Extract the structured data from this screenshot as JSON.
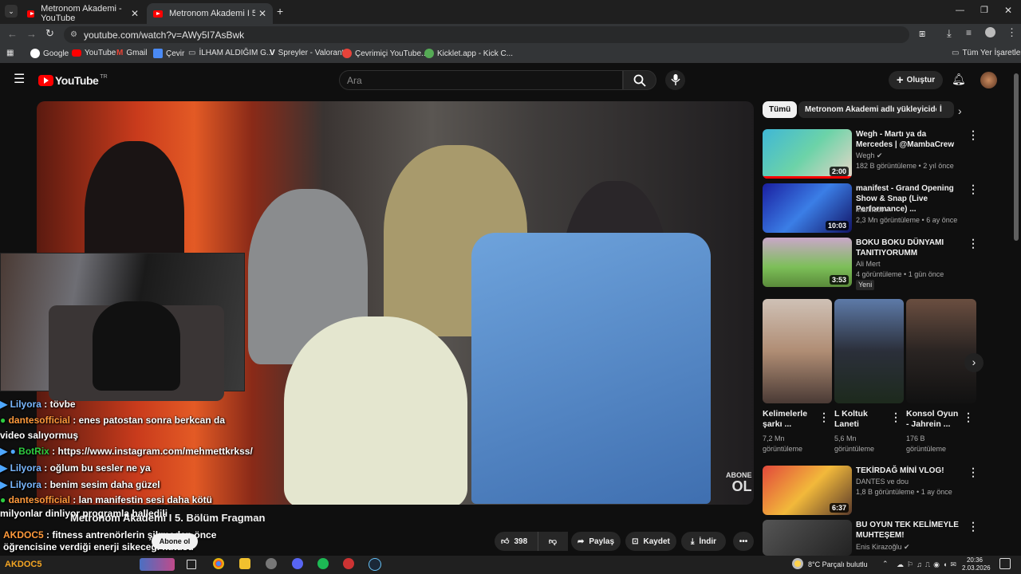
{
  "browser": {
    "tabs": [
      {
        "title": "Metronom Akademi - YouTube",
        "active": false
      },
      {
        "title": "Metronom Akademi I 5. Bölüm",
        "active": true
      }
    ],
    "url": "youtube.com/watch?v=AWy5I7AsBwk",
    "bookmarks": [
      "Google",
      "YouTube",
      "Gmail",
      "Çevir",
      "İLHAM ALDIĞIM G...",
      "Spreyler - Valorant",
      "Çevrimiçi YouTube...",
      "Kicklet.app - Kick C..."
    ],
    "all_bookmarks": "Tüm Yer İşaretleri"
  },
  "youtube": {
    "logo_text": "YouTube",
    "logo_region": "TR",
    "search_placeholder": "Ara",
    "create_label": "Oluştur"
  },
  "overlay": {
    "video_title": "Metronom Akademi I 5. Bölüm Fragman",
    "abone_ol_stamp": "ABONE",
    "abone_ol_stamp2": "OL",
    "subscribe_label": "Abone ol",
    "channel_partial": "Metronom Akademi",
    "chat": [
      {
        "user": "Lilyora",
        "msg": " : tövbe",
        "color": "#7ab8ff"
      },
      {
        "user": "dantesofficial",
        "msg": " : enes patostan sonra berkcan da video salıyormuş",
        "color": "#ff9a3c"
      },
      {
        "user": "BotRix",
        "msg": " : https://www.instagram.com/mehmettkrkss/",
        "color": "#2ecc40"
      },
      {
        "user": "Lilyora",
        "msg": " : oğlum bu sesler ne ya",
        "color": "#7ab8ff"
      },
      {
        "user": "Lilyora",
        "msg": " : benim sesim daha güzel",
        "color": "#7ab8ff"
      },
      {
        "user": "dantesofficial",
        "msg": " : lan manifestin sesi daha kötü milyonlar dinliyor programla halledili",
        "color": "#ff9a3c"
      },
      {
        "user": "AKDOC5",
        "msg": " : fitness antrenörlerin şikmeden önce öğrencisine verdiği enerji sikecegi kutusu",
        "color": "#ff9a3c"
      }
    ]
  },
  "actions": {
    "likes": "398",
    "share": "Paylaş",
    "save": "Kaydet",
    "download": "İndir"
  },
  "sidebar": {
    "chips": [
      "Tümü",
      "Metronom Akademi adlı yükleyiciden",
      "İ"
    ],
    "videos": [
      {
        "title": "Wegh - Martı ya da Mercedes | @MambaCrew",
        "channel": "Wegh",
        "meta": "182 B görüntüleme • 2 yıl önce",
        "duration": "2:00",
        "verified": true
      },
      {
        "title": "manifest - Grand Opening Show & Snap (Live Performance) ...",
        "channel": "manifest",
        "meta": "2,3 Mn görüntüleme • 6 ay önce",
        "duration": "10:03",
        "verified": true
      },
      {
        "title": "BOKU BOKU DÜNYAMI TANITIYORUMM",
        "channel": "Ali Mert",
        "meta": "4 görüntüleme • 1 gün önce",
        "duration": "3:53",
        "badge": "Yeni"
      },
      {
        "title": "TEKİRDAĞ MİNİ VLOG!",
        "channel": "DANTES ve dou",
        "meta": "1,8 B görüntüleme • 1 ay önce",
        "duration": "6:37"
      },
      {
        "title": "BU OYUN TEK KELİMEYLE MUHTEŞEM!",
        "channel": "Enis Kirazoğlu",
        "meta": "",
        "duration": "",
        "verified": true
      }
    ],
    "shorts": [
      {
        "title": "Kelimelerle şarkı ...",
        "views": "7,2 Mn görüntüleme"
      },
      {
        "title": "L Koltuk Laneti",
        "views": "5,6 Mn görüntüleme"
      },
      {
        "title": "Konsol Oyun - Jahrein ...",
        "views": "176 B görüntüleme"
      }
    ]
  },
  "taskbar": {
    "weather": "8°C  Parçalı bulutlu",
    "time": "20:36",
    "date": "2.03.2026",
    "left_label": "AKDOC5"
  }
}
